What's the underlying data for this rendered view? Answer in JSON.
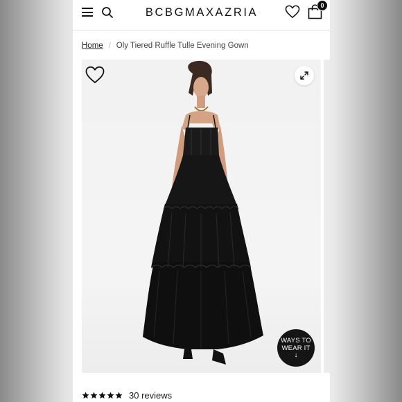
{
  "header": {
    "logo_text": "BCBGMAXAZRIA",
    "cart_count": "0",
    "icons": [
      "hamburger-menu-icon",
      "search-icon",
      "heart-icon",
      "shopping-bag-icon"
    ]
  },
  "breadcrumb": {
    "home": "Home",
    "current": "Oly Tiered Ruffle Tulle Evening Gown"
  },
  "gallery": {
    "ways_line1": "WAYS TO",
    "ways_line2": "WEAR IT",
    "ways_arrow": "↓",
    "icons": [
      "heart-outline-icon",
      "expand-icon"
    ]
  },
  "reviews": {
    "rating": 5,
    "count_text": "30 reviews"
  },
  "colors": {
    "background_side": "#e6e6e6",
    "page": "#ffffff",
    "text": "#111111",
    "accent_dark": "#151515"
  }
}
